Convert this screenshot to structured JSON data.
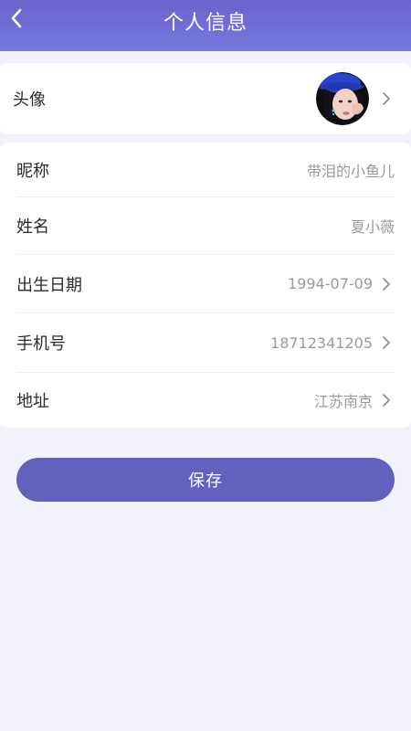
{
  "header": {
    "title": "个人信息",
    "back_icon": "chevron-left-icon"
  },
  "avatar_row": {
    "label": "头像",
    "chevron_icon": "chevron-right-icon"
  },
  "info_rows": [
    {
      "label": "昵称",
      "value": "带泪的小鱼儿",
      "has_chevron": false
    },
    {
      "label": "姓名",
      "value": "夏小薇",
      "has_chevron": false
    },
    {
      "label": "出生日期",
      "value": "1994-07-09",
      "has_chevron": true
    },
    {
      "label": "手机号",
      "value": "18712341205",
      "has_chevron": true
    },
    {
      "label": "地址",
      "value": "江苏南京",
      "has_chevron": true
    }
  ],
  "save_button": {
    "label": "保存"
  },
  "colors": {
    "header_gradient_start": "#6c62cc",
    "header_gradient_end": "#7679dd",
    "background": "#f2f2fb",
    "button": "#6460bd",
    "label_text": "#2b2b2b",
    "value_text": "#9a9a9a"
  }
}
